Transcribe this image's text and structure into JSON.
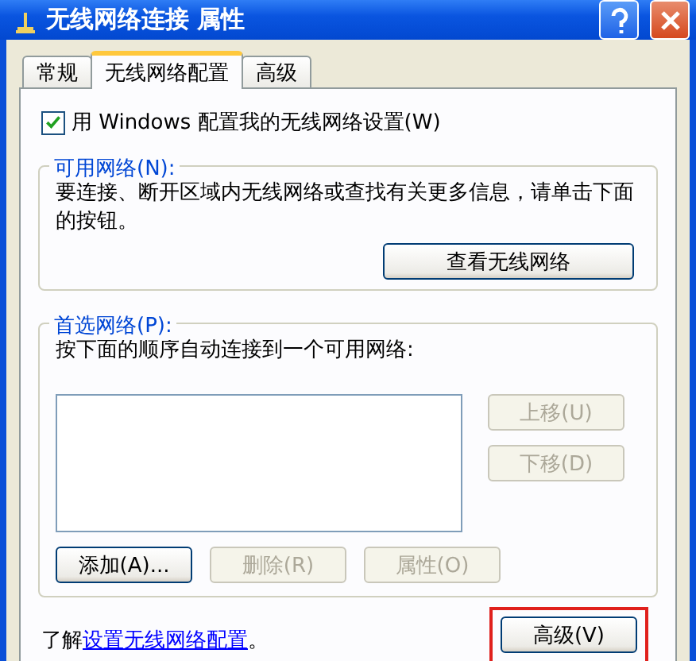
{
  "window": {
    "title": "无线网络连接 属性"
  },
  "tabs": [
    {
      "label": "常规",
      "selected": false
    },
    {
      "label": "无线网络配置",
      "selected": true
    },
    {
      "label": "高级",
      "selected": false
    }
  ],
  "use_windows_checkbox": {
    "label": "用 Windows 配置我的无线网络设置(W)",
    "checked": true
  },
  "available_networks": {
    "title": "可用网络(N):",
    "description": "要连接、断开区域内无线网络或查找有关更多信息，请单击下面的按钮。",
    "button": {
      "label": "查看无线网络",
      "disabled": false
    }
  },
  "preferred_networks": {
    "title": "首选网络(P):",
    "description": "按下面的顺序自动连接到一个可用网络:",
    "side_buttons": [
      {
        "label": "上移(U)",
        "disabled": true
      },
      {
        "label": "下移(D)",
        "disabled": true
      }
    ],
    "buttons": [
      {
        "label": "添加(A)...",
        "disabled": false
      },
      {
        "label": "删除(R)",
        "disabled": true
      },
      {
        "label": "属性(O)",
        "disabled": true
      }
    ]
  },
  "learn_more": {
    "prefix": "了解",
    "link": "设置无线网络配置",
    "suffix": "。"
  },
  "advanced_button": {
    "label": "高级(V)",
    "disabled": false,
    "highlighted": true
  }
}
